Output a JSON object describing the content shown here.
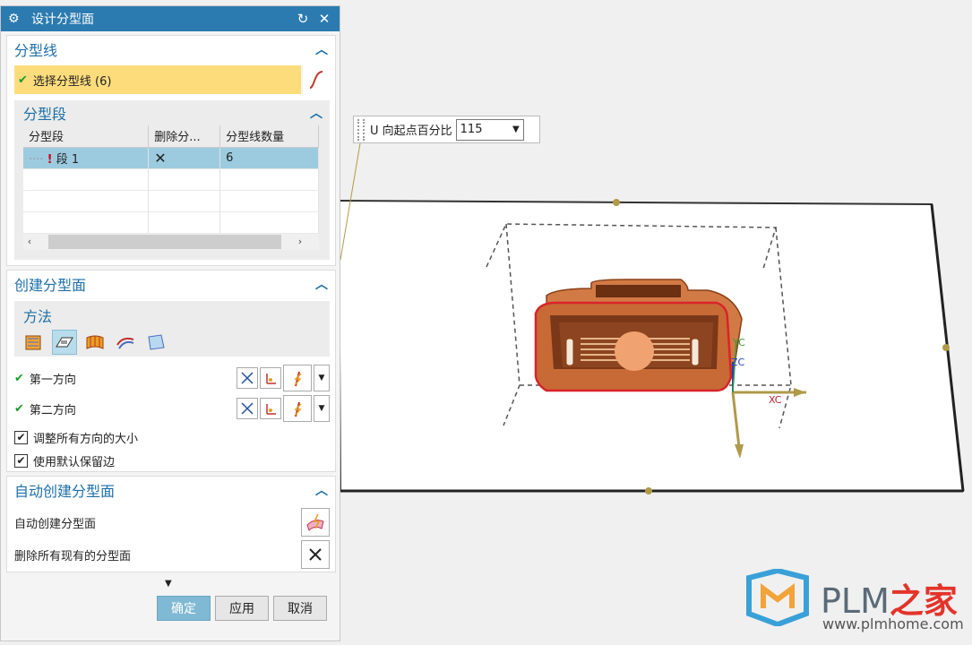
{
  "dialog": {
    "title": "设计分型面",
    "parting_line": {
      "header": "分型线",
      "select_label": "选择分型线 (6)"
    },
    "parting_segment": {
      "header": "分型段",
      "columns": [
        "分型段",
        "删除分...",
        "分型线数量"
      ],
      "rows": [
        {
          "segment": "段 1",
          "delete": "✕",
          "count": "6"
        }
      ]
    },
    "create": {
      "header": "创建分型面",
      "method_label": "方法",
      "first_direction": "第一方向",
      "second_direction": "第二方向",
      "resize_all": "调整所有方向的大小",
      "use_default_margin": "使用默认保留边"
    },
    "auto": {
      "header": "自动创建分型面",
      "auto_create": "自动创建分型面",
      "delete_all": "删除所有现有的分型面"
    },
    "buttons": {
      "ok": "确定",
      "apply": "应用",
      "cancel": "取消"
    }
  },
  "u_field": {
    "label": "U 向起点百分比",
    "value": "115"
  },
  "axes": {
    "xc": "XC",
    "yc": "YC",
    "zc": "ZC"
  },
  "watermark": {
    "brand_latin": "PLM",
    "brand_cn": "之家",
    "url": "www.plmhome.com"
  },
  "colors": {
    "title_bar": "#2b7bb0",
    "selected_row": "#fddc7c",
    "section_header": "#1c6fa8",
    "part_copper": "#d27a45"
  }
}
